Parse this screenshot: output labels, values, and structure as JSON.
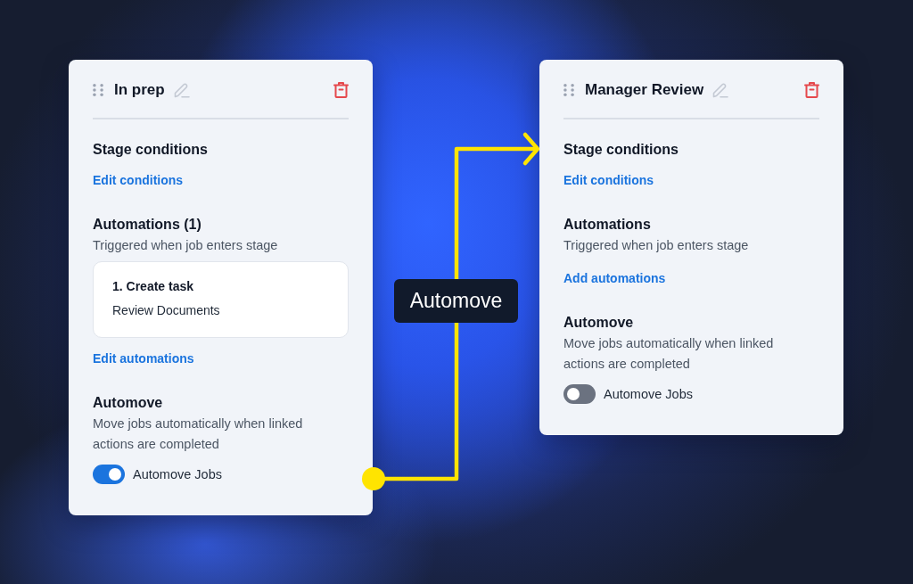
{
  "stages": [
    {
      "title": "In prep",
      "conditions": {
        "heading": "Stage conditions",
        "link": "Edit conditions"
      },
      "automations": {
        "heading": "Automations (1)",
        "description": "Triggered when job enters stage",
        "items": [
          {
            "title": "1. Create task",
            "detail": "Review Documents"
          }
        ],
        "link": "Edit automations"
      },
      "automove": {
        "heading": "Automove",
        "description": "Move jobs automatically when linked actions are completed",
        "toggle": {
          "label": "Automove Jobs",
          "on": true
        }
      }
    },
    {
      "title": "Manager Review",
      "conditions": {
        "heading": "Stage conditions",
        "link": "Edit conditions"
      },
      "automations": {
        "heading": "Automations",
        "description": "Triggered when job enters stage",
        "link": "Add automations"
      },
      "automove": {
        "heading": "Automove",
        "description": "Move jobs automatically when linked actions are completed",
        "toggle": {
          "label": "Automove Jobs",
          "on": false
        }
      }
    }
  ],
  "connector": {
    "label": "Automove"
  }
}
